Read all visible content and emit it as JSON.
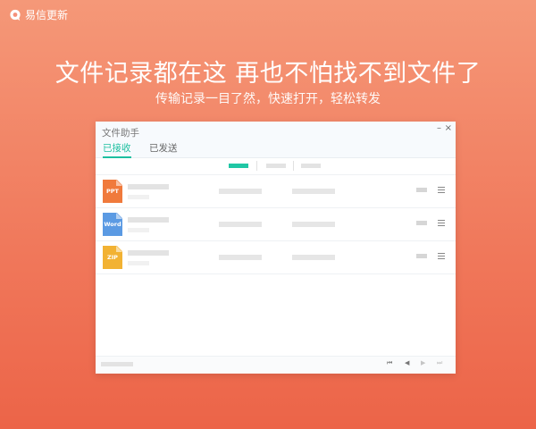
{
  "brand": {
    "name": "易信更新",
    "logo_icon": "chat-bubble-icon"
  },
  "hero": {
    "title": "文件记录都在这 再也不怕找不到文件了",
    "subtitle": "传输记录一目了然，快速打开，轻松转发"
  },
  "window": {
    "title": "文件助手",
    "minimize_label": "–",
    "close_label": "×",
    "tabs": [
      {
        "label": "已接收",
        "active": true
      },
      {
        "label": "已发送",
        "active": false
      }
    ],
    "accent_color": "#1dbfa0"
  },
  "files": [
    {
      "type_label": "PPT",
      "color": "#f07a3c"
    },
    {
      "type_label": "Word",
      "color": "#5b9ae3"
    },
    {
      "type_label": "ZIP",
      "color": "#f2b233"
    }
  ],
  "pagination": {
    "first_icon": "first-page-icon",
    "prev_icon": "prev-page-icon",
    "next_icon": "next-page-icon",
    "last_icon": "last-page-icon"
  }
}
